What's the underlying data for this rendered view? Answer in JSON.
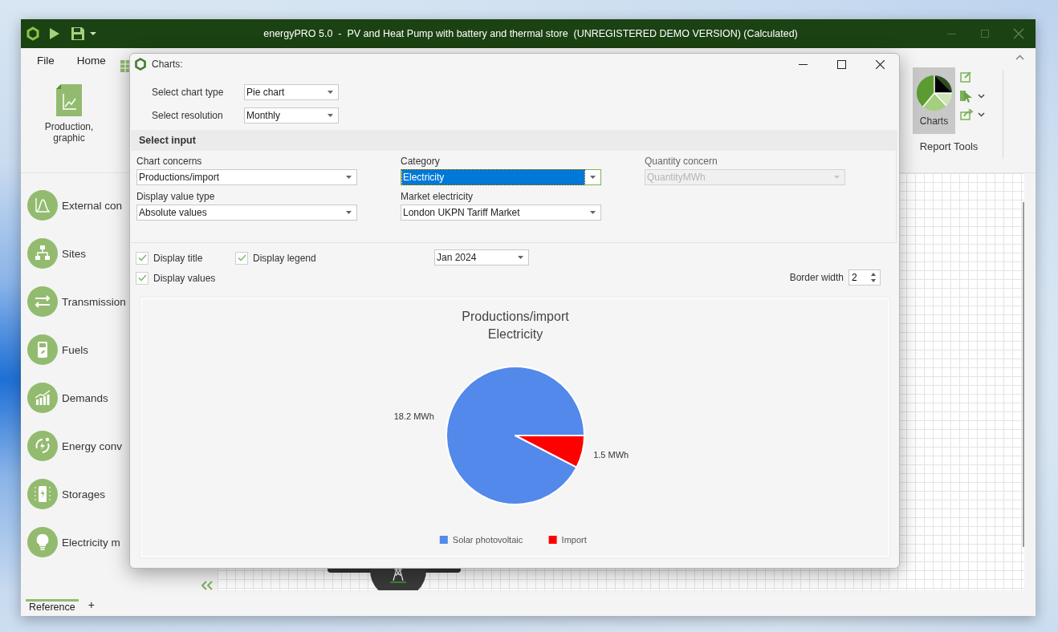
{
  "window": {
    "title": "energyPRO 5.0  -  PV and Heat Pump with battery and thermal store  (UNREGISTERED DEMO VERSION) (Calculated)"
  },
  "menu": [
    "File",
    "Home"
  ],
  "ribbon": {
    "production_button": "Production, graphic",
    "charts_button": {
      "label": "Charts",
      "selected": true
    },
    "group_label": "Report Tools"
  },
  "sidebar": {
    "items": [
      {
        "label": "External con"
      },
      {
        "label": "Sites"
      },
      {
        "label": "Transmission"
      },
      {
        "label": "Fuels"
      },
      {
        "label": "Demands"
      },
      {
        "label": "Energy conv"
      },
      {
        "label": "Storages"
      },
      {
        "label": "Electricity m"
      }
    ]
  },
  "bottom_tabs": [
    {
      "label": "Reference",
      "selected": true
    }
  ],
  "add_tab": "+",
  "dialog": {
    "title": "Charts:",
    "settings": [
      {
        "label": "Select chart type",
        "value": "Pie chart"
      },
      {
        "label": "Select resolution",
        "value": "Monthly"
      }
    ],
    "section": "Select input",
    "fields": [
      {
        "label": "Chart concerns",
        "value": "Productions/import",
        "selected": false,
        "disabled": false
      },
      {
        "label": "Category",
        "value": "Electricity",
        "selected": true,
        "disabled": false
      },
      {
        "label": "Quantity concern",
        "value": "QuantityMWh",
        "selected": false,
        "disabled": true
      },
      {
        "label": "Display value type",
        "value": "Absolute values",
        "selected": false,
        "disabled": false
      },
      {
        "label": "Market electricity",
        "value": "London UKPN Tariff Market",
        "selected": false,
        "disabled": false
      }
    ],
    "checkboxes": [
      {
        "label": "Display title",
        "checked": true
      },
      {
        "label": "Display legend",
        "checked": true
      },
      {
        "label": "Display values",
        "checked": true
      }
    ],
    "period": "Jan 2024",
    "border_width": {
      "label": "Border width",
      "value": "2"
    },
    "chart_data": {
      "type": "pie",
      "title": "Productions/import\nElectricity",
      "categories": [
        "Solar photovoltaic",
        "Import"
      ],
      "values": [
        18.2,
        1.5
      ],
      "colors": [
        "#5289ea",
        "#ff0000"
      ],
      "legend": "bottom",
      "value_labels": [
        "18.2 MWh",
        "1.5 MWh"
      ]
    }
  }
}
